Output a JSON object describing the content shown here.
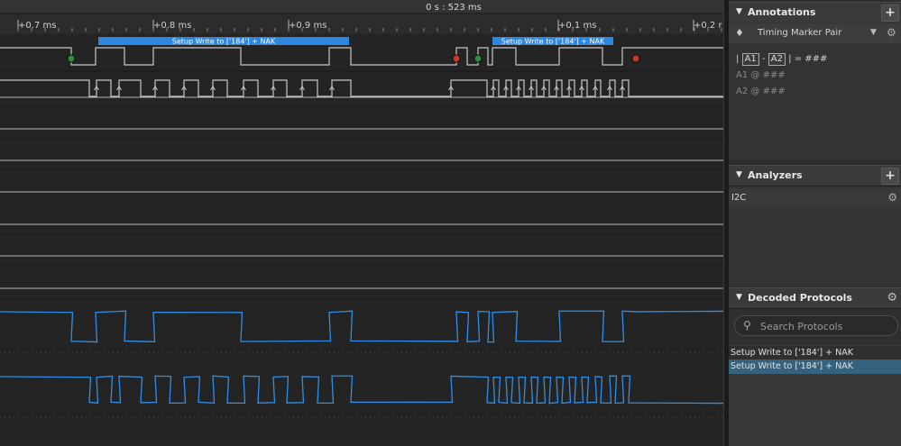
{
  "ruler": {
    "center_time": "0 s : 523 ms",
    "ticks": [
      "+0.7 ms",
      "+0.8 ms",
      "+0.9 ms",
      "+0.1 ms",
      "+0.2 r"
    ]
  },
  "bubbles": [
    {
      "label": "Setup Write to ['184'] + NAK"
    },
    {
      "label": "Setup Write to ['184'] + NAK"
    }
  ],
  "colors": {
    "bubble": "#2d86e0",
    "analog": "#2f8fe8",
    "digital": "#c8c8c8",
    "start_marker": "#2f8f3a",
    "stop_marker": "#c43a2a",
    "selected_row": "#35637f"
  },
  "panel": {
    "annotations": {
      "title": "Annotations",
      "add_icon": "+",
      "marker_pair": "Timing Marker Pair",
      "lines": [
        {
          "a": "A1",
          "sep": "-",
          "b": "A2",
          "eq": "= ###"
        },
        {
          "label": "A1",
          "at": "@",
          "value": "###"
        },
        {
          "label": "A2",
          "at": "@",
          "value": "###"
        }
      ]
    },
    "analyzers": {
      "title": "Analyzers",
      "add_icon": "+",
      "items": [
        "I2C"
      ]
    },
    "decoded": {
      "title": "Decoded Protocols",
      "search_placeholder": "Search Protocols",
      "rows": [
        "Setup Write to ['184'] + NAK",
        "Setup Write to ['184'] + NAK"
      ],
      "selected_index": 1
    }
  }
}
